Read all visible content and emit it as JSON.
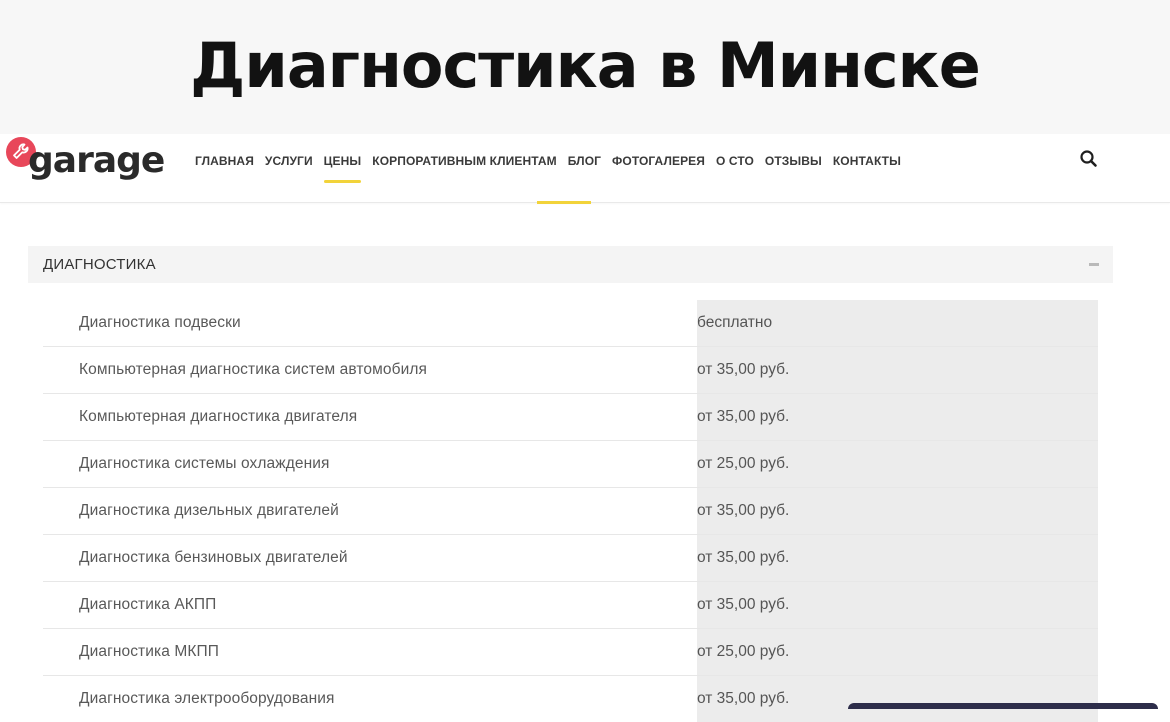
{
  "banner": {
    "title": "Диагностика в Минске"
  },
  "header": {
    "logo_text": "garage",
    "logo_badge_color": "#e8475a",
    "accent_color": "#f2d33a",
    "nav": [
      {
        "label": "ГЛАВНАЯ"
      },
      {
        "label": "УСЛУГИ"
      },
      {
        "label": "ЦЕНЫ",
        "active": true
      },
      {
        "label": "КОРПОРАТИВНЫМ КЛИЕНТАМ"
      },
      {
        "label": "БЛОГ"
      },
      {
        "label": "ФОТОГАЛЕРЕЯ"
      },
      {
        "label": "О СТО"
      },
      {
        "label": "ОТЗЫВЫ"
      },
      {
        "label": "КОНТАКТЫ"
      }
    ],
    "search_icon": "search-icon"
  },
  "section": {
    "title": "ДИАГНОСТИКА",
    "toggle_icon": "minus-icon"
  },
  "prices": [
    {
      "name": "Диагностика подвески",
      "price": "бесплатно"
    },
    {
      "name": "Компьютерная диагностика систем автомобиля",
      "price": "от 35,00 руб."
    },
    {
      "name": "Компьютерная диагностика двигателя",
      "price": "от 35,00 руб."
    },
    {
      "name": "Диагностика системы охлаждения",
      "price": "от 25,00 руб."
    },
    {
      "name": "Диагностика дизельных двигателей",
      "price": "от 35,00 руб."
    },
    {
      "name": "Диагностика бензиновых двигателей",
      "price": "от 35,00 руб."
    },
    {
      "name": "Диагностика АКПП",
      "price": "от 35,00 руб."
    },
    {
      "name": "Диагностика МКПП",
      "price": "от 25,00 руб."
    },
    {
      "name": "Диагностика электрооборудования",
      "price": "от 35,00 руб."
    }
  ]
}
